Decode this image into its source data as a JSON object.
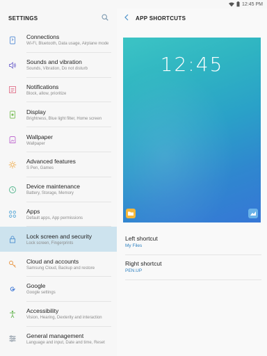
{
  "status_bar": {
    "time": "12:45 PM"
  },
  "settings": {
    "title": "SETTINGS",
    "items": [
      {
        "title": "Connections",
        "subtitle": "Wi-Fi, Bluetooth, Data usage, Airplane mode",
        "icon": "connections-icon"
      },
      {
        "title": "Sounds and vibration",
        "subtitle": "Sounds, Vibration, Do not disturb",
        "icon": "sound-icon"
      },
      {
        "title": "Notifications",
        "subtitle": "Block, allow, prioritize",
        "icon": "notifications-icon"
      },
      {
        "title": "Display",
        "subtitle": "Brightness, Blue light filter, Home screen",
        "icon": "display-icon"
      },
      {
        "title": "Wallpaper",
        "subtitle": "Wallpaper",
        "icon": "wallpaper-icon"
      },
      {
        "title": "Advanced features",
        "subtitle": "S Pen, Games",
        "icon": "advanced-features-icon"
      },
      {
        "title": "Device maintenance",
        "subtitle": "Battery, Storage, Memory",
        "icon": "device-maintenance-icon"
      },
      {
        "title": "Apps",
        "subtitle": "Default apps, App permissions",
        "icon": "apps-icon"
      },
      {
        "title": "Lock screen and security",
        "subtitle": "Lock screen, Fingerprints",
        "icon": "lock-icon"
      },
      {
        "title": "Cloud and accounts",
        "subtitle": "Samsung Cloud, Backup and restore",
        "icon": "key-icon"
      },
      {
        "title": "Google",
        "subtitle": "Google settings",
        "icon": "google-icon"
      },
      {
        "title": "Accessibility",
        "subtitle": "Vision, Hearing, Dexterity and interaction",
        "icon": "accessibility-icon"
      },
      {
        "title": "General management",
        "subtitle": "Language and input, Date and time, Reset",
        "icon": "general-management-icon"
      }
    ],
    "selected_index": 8
  },
  "app_shortcuts": {
    "title": "APP SHORTCUTS",
    "preview_time": "12:45",
    "left_icon": "my-files-folder-icon",
    "right_icon": "pen-up-icon",
    "left_shortcut": {
      "label": "Left shortcut",
      "value": "My Files"
    },
    "right_shortcut": {
      "label": "Right shortcut",
      "value": "PEN.UP"
    }
  },
  "colors": {
    "selected_row": "#cde3ee",
    "accent_link": "#2c7fbf",
    "preview_gradient_start": "#3cc4c4",
    "preview_gradient_end": "#3677d6"
  }
}
